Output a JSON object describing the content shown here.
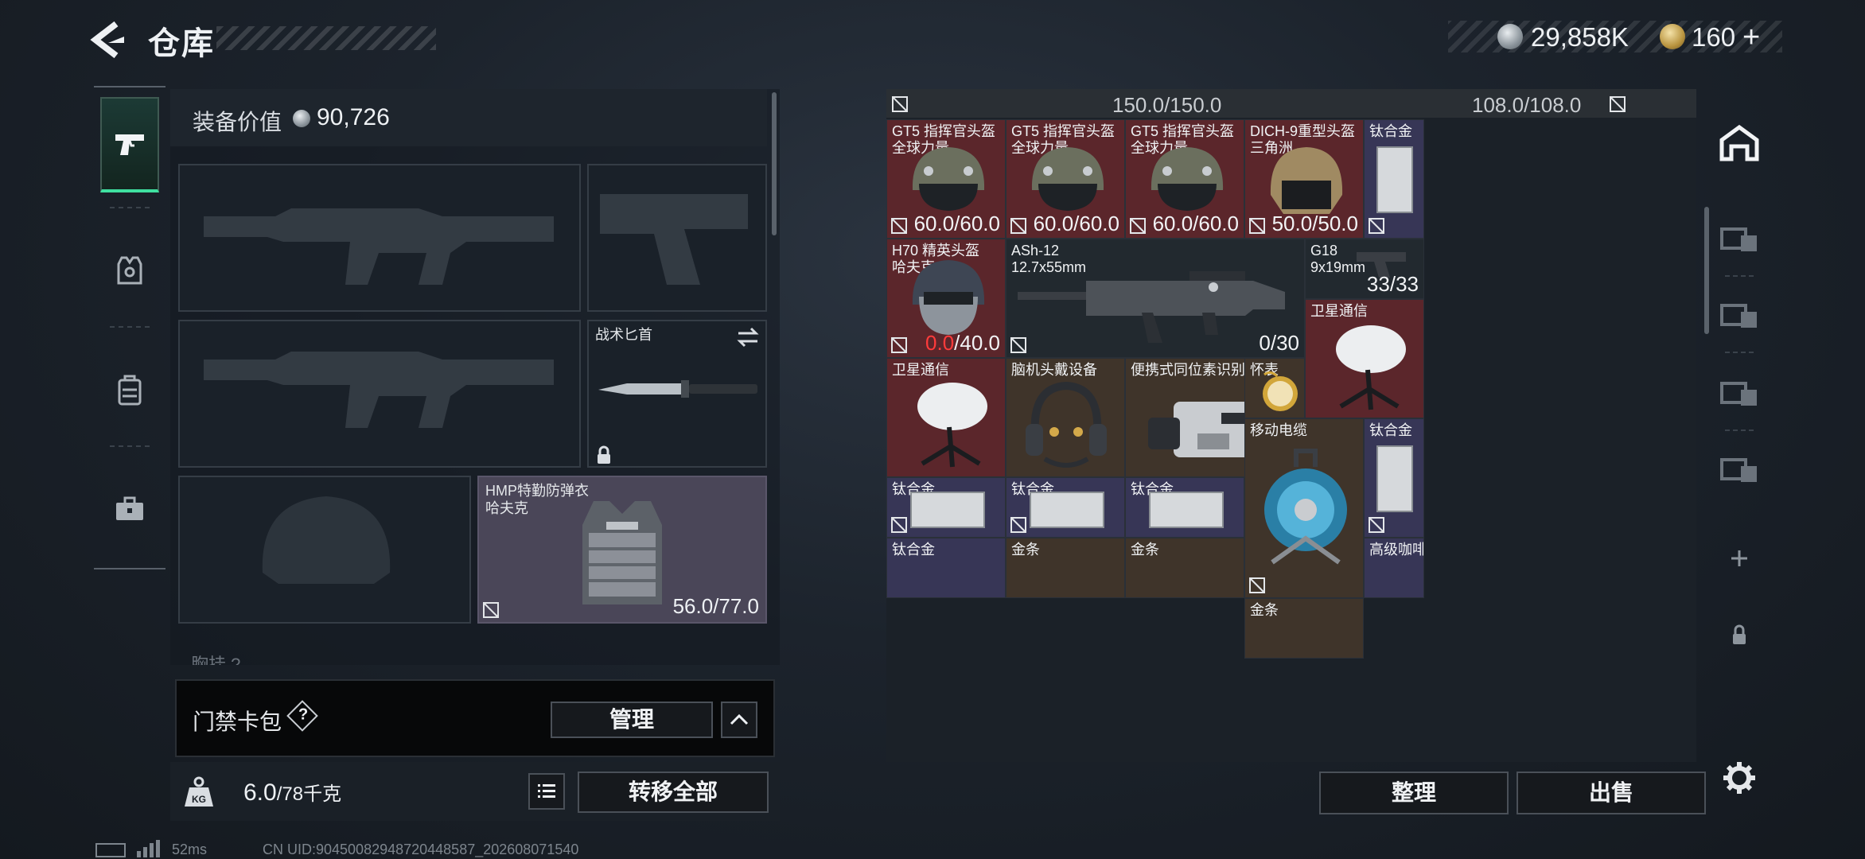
{
  "header": {
    "title": "仓库"
  },
  "currency": {
    "silver": "29,858K",
    "gold": "160",
    "plus": "+"
  },
  "loadout": {
    "value_label": "装备价值",
    "value": "90,726",
    "knife_label": "战术匕首",
    "armor_name": "HMP特勤防弹衣",
    "armor_brand": "哈夫克",
    "armor_durability": "56.0/77.0",
    "chest_label": "胸挂 ?"
  },
  "keycard": {
    "label": "门禁卡包",
    "help": "?",
    "manage": "管理"
  },
  "weight": {
    "current": "6.0",
    "max": "/78千克",
    "transfer_all": "转移全部"
  },
  "storage": {
    "top_values": [
      "150.0/150.0",
      "108.0/108.0"
    ],
    "items": [
      {
        "id": "gt5-1",
        "name": "GT5 指挥官头盔",
        "sub": "全球力量",
        "value": "60.0/60.0"
      },
      {
        "id": "gt5-2",
        "name": "GT5 指挥官头盔",
        "sub": "全球力量",
        "value": "60.0/60.0"
      },
      {
        "id": "gt5-3",
        "name": "GT5 指挥官头盔",
        "sub": "全球力量",
        "value": "60.0/60.0"
      },
      {
        "id": "dich9",
        "name": "DICH-9重型头盔",
        "sub": "三角洲",
        "value": "50.0/50.0"
      },
      {
        "id": "ti-1",
        "name": "钛合金"
      },
      {
        "id": "h70",
        "name": "H70 精英头盔",
        "sub": "哈夫克",
        "value_red": "0.0",
        "value": "/40.0"
      },
      {
        "id": "ash12",
        "name": "ASh-12",
        "sub": "12.7x55mm",
        "value": "0/30"
      },
      {
        "id": "g18",
        "name": "G18",
        "sub": "9x19mm",
        "value": "33/33"
      },
      {
        "id": "sat-1",
        "name": "卫星通信"
      },
      {
        "id": "sat-2",
        "name": "卫星通信"
      },
      {
        "id": "bci",
        "name": "脑机头戴设备"
      },
      {
        "id": "isotope",
        "name": "便携式同位素识别仪"
      },
      {
        "id": "watch",
        "name": "怀表"
      },
      {
        "id": "cable",
        "name": "移动电缆"
      },
      {
        "id": "ti-2",
        "name": "钛合金"
      },
      {
        "id": "ti-3",
        "name": "钛合金"
      },
      {
        "id": "ti-4",
        "name": "钛合金"
      },
      {
        "id": "ti-5",
        "name": "钛合金"
      },
      {
        "id": "ti-6",
        "name": "钛合金"
      },
      {
        "id": "gold-1",
        "name": "金条"
      },
      {
        "id": "gold-2",
        "name": "金条"
      },
      {
        "id": "gold-3",
        "name": "金条"
      },
      {
        "id": "coffee",
        "name": "高级咖啡豆"
      }
    ],
    "sort": "整理",
    "sell": "出售"
  },
  "footer": {
    "ping": "52ms",
    "uid": "CN UID:90450082948720448587_202608071540"
  }
}
